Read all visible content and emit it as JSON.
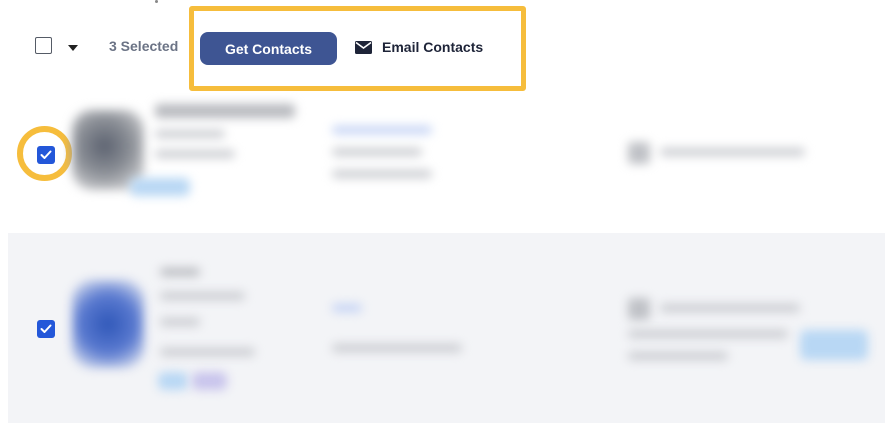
{
  "toolbar": {
    "selected_count_label": "3 Selected",
    "get_contacts_label": "Get Contacts",
    "email_contacts_label": "Email Contacts"
  },
  "rows": [
    {
      "checked": true
    },
    {
      "checked": true
    }
  ],
  "colors": {
    "accent": "#3e5593",
    "checkbox": "#2357d9",
    "highlight": "#f6bd3c",
    "selected_text": "#6b7385"
  }
}
